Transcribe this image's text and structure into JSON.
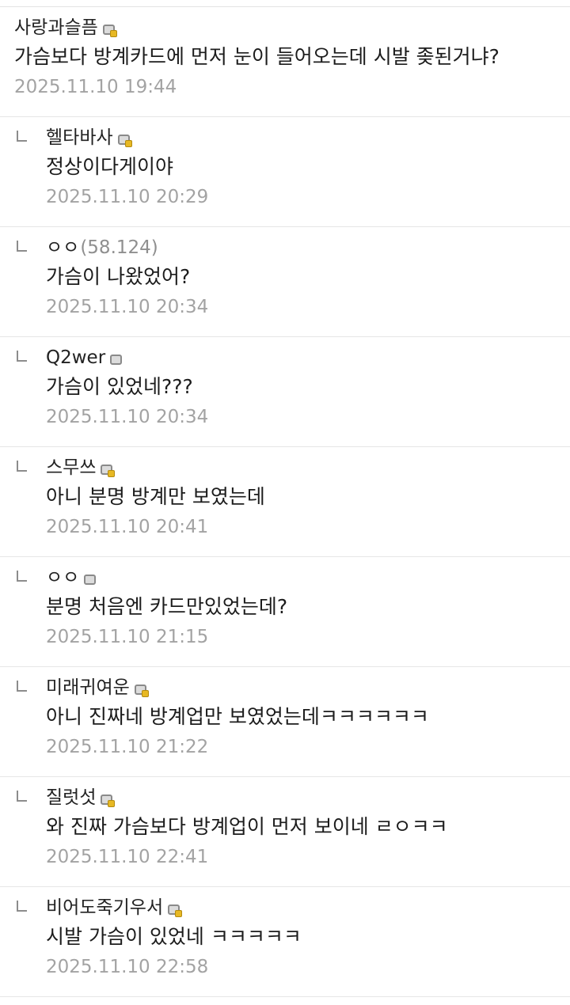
{
  "comments": [
    {
      "nick": "사랑과슬픔",
      "ip": "",
      "badge": "gold",
      "text": "가슴보다 방계카드에 먼저 눈이 들어오는데 시발 좆된거냐?",
      "date": "2025.11.10 19:44",
      "reply": false
    },
    {
      "nick": "헬타바사",
      "ip": "",
      "badge": "gold",
      "text": "정상이다게이야",
      "date": "2025.11.10 20:29",
      "reply": true
    },
    {
      "nick": "ㅇㅇ",
      "ip": "(58.124)",
      "badge": "none",
      "text": "가슴이 나왔었어?",
      "date": "2025.11.10 20:34",
      "reply": true
    },
    {
      "nick": "Q2wer",
      "ip": "",
      "badge": "grey",
      "text": "가슴이 있었네???",
      "date": "2025.11.10 20:34",
      "reply": true
    },
    {
      "nick": "스무쓰",
      "ip": "",
      "badge": "gold",
      "text": "아니 분명 방계만 보였는데",
      "date": "2025.11.10 20:41",
      "reply": true
    },
    {
      "nick": "ㅇㅇ",
      "ip": "",
      "badge": "grey",
      "text": "분명 처음엔 카드만있었는데?",
      "date": "2025.11.10 21:15",
      "reply": true
    },
    {
      "nick": "미래귀여운",
      "ip": "",
      "badge": "gold",
      "text": "아니 진짜네 방계업만 보였었는데ㅋㅋㅋㅋㅋㅋ",
      "date": "2025.11.10 21:22",
      "reply": true
    },
    {
      "nick": "질럿섯",
      "ip": "",
      "badge": "gold",
      "text": "와 진짜 가슴보다 방계업이 먼저 보이네 ㄹㅇㅋㅋ",
      "date": "2025.11.10 22:41",
      "reply": true
    },
    {
      "nick": "비어도죽기우서",
      "ip": "",
      "badge": "gold",
      "text": "시발 가슴이 있었네 ㅋㅋㅋㅋㅋ",
      "date": "2025.11.10 22:58",
      "reply": true
    }
  ]
}
